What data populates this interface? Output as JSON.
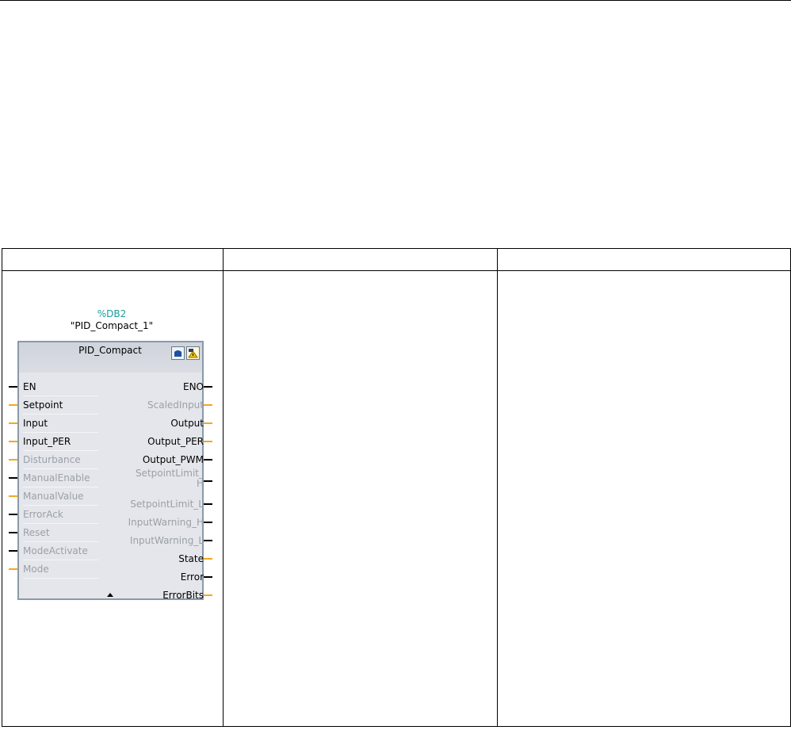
{
  "block": {
    "instance_number": "%DB2",
    "instance_name": "\"PID_Compact_1\"",
    "type_name": "PID_Compact",
    "icons": [
      "database-icon",
      "warning-icon"
    ]
  },
  "colors": {
    "bool_pin": "#000000",
    "real_pin": "#f5a623",
    "active_text": "#000000",
    "inactive_text": "#9aa0a8",
    "instance_number": "#1a9e9a"
  },
  "inputs": [
    {
      "label": "EN",
      "active": true,
      "type": "bool"
    },
    {
      "label": "Setpoint",
      "active": true,
      "type": "real"
    },
    {
      "label": "Input",
      "active": true,
      "type": "real"
    },
    {
      "label": "Input_PER",
      "active": true,
      "type": "real"
    },
    {
      "label": "Disturbance",
      "active": false,
      "type": "real"
    },
    {
      "label": "ManualEnable",
      "active": false,
      "type": "bool"
    },
    {
      "label": "ManualValue",
      "active": false,
      "type": "real"
    },
    {
      "label": "ErrorAck",
      "active": false,
      "type": "bool"
    },
    {
      "label": "Reset",
      "active": false,
      "type": "bool"
    },
    {
      "label": "ModeActivate",
      "active": false,
      "type": "bool"
    },
    {
      "label": "Mode",
      "active": false,
      "type": "real"
    }
  ],
  "outputs": [
    {
      "label": "ENO",
      "active": true,
      "type": "bool"
    },
    {
      "label": "ScaledInput",
      "active": false,
      "type": "real"
    },
    {
      "label": "Output",
      "active": true,
      "type": "real"
    },
    {
      "label": "Output_PER",
      "active": true,
      "type": "real"
    },
    {
      "label": "Output_PWM",
      "active": true,
      "type": "bool"
    },
    {
      "label": "SetpointLimit_H",
      "active": false,
      "type": "bool",
      "wrap": true
    },
    {
      "label": "SetpointLimit_L",
      "active": false,
      "type": "bool"
    },
    {
      "label": "InputWarning_H",
      "active": false,
      "type": "bool"
    },
    {
      "label": "InputWarning_L",
      "active": false,
      "type": "bool"
    },
    {
      "label": "State",
      "active": true,
      "type": "real"
    },
    {
      "label": "Error",
      "active": true,
      "type": "bool"
    },
    {
      "label": "ErrorBits",
      "active": true,
      "type": "real"
    }
  ]
}
